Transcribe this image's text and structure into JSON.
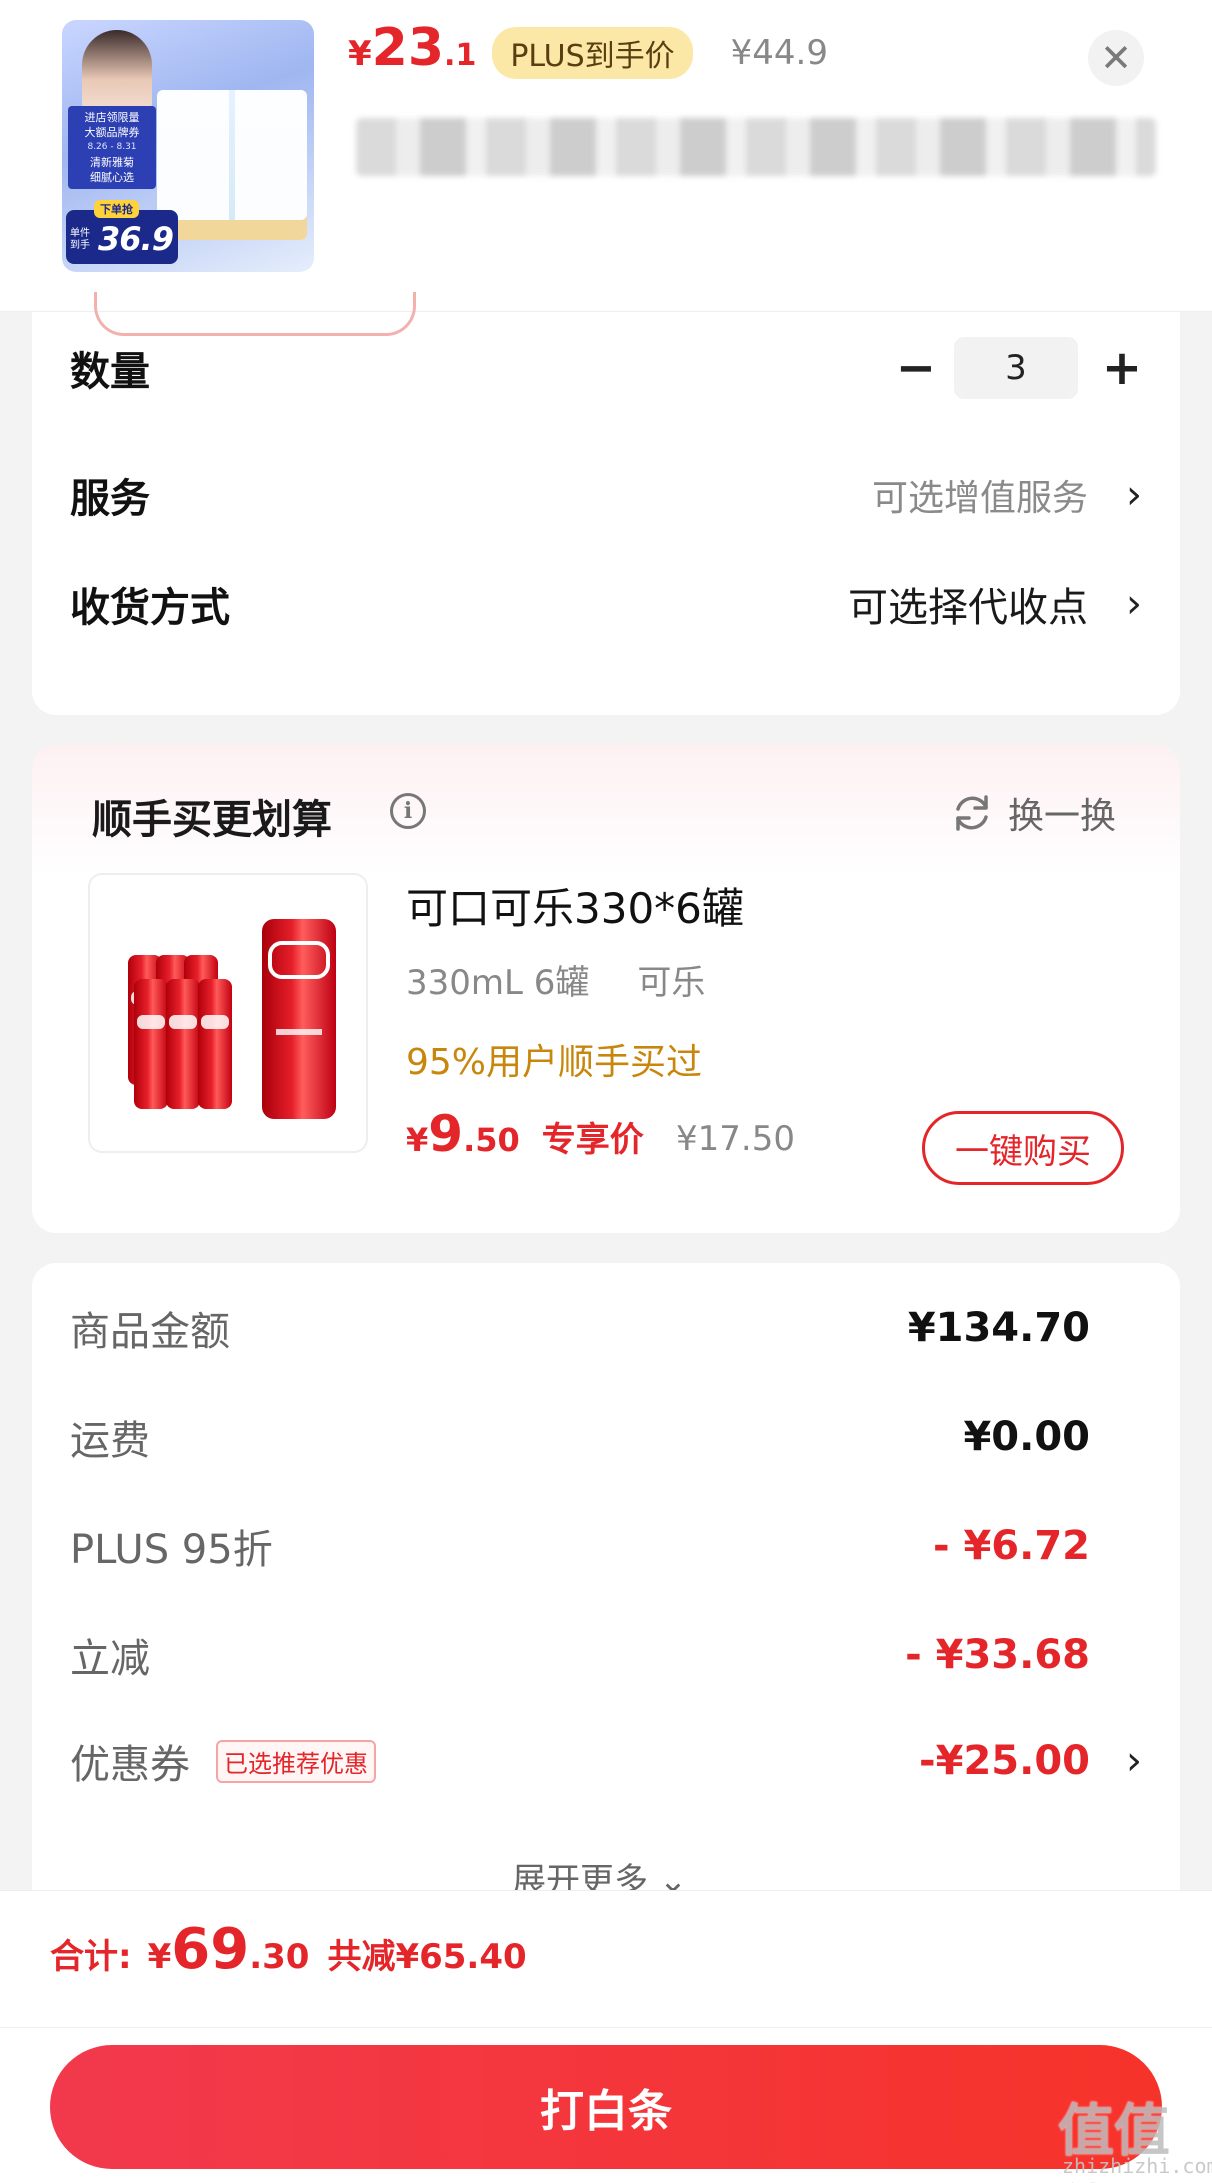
{
  "header": {
    "thumb": {
      "promo_line1": "进店领限量",
      "promo_line2": "大额品牌券",
      "promo_dates": "8.26 - 8.31",
      "promo_line3": "清新雅菊",
      "promo_line4": "细腻心选",
      "badge_tag": "下单抢",
      "badge_label": "单件到手",
      "badge_price": "36.9"
    },
    "price": {
      "currency": "¥",
      "integer": "23",
      "decimal": ".1"
    },
    "plus_tag": "PLUS到手价",
    "original_price": "¥44.9",
    "close_icon": "✕"
  },
  "options": {
    "quantity_label": "数量",
    "quantity_value": "3",
    "minus": "−",
    "plus": "+",
    "service_label": "服务",
    "service_value": "可选增值服务",
    "delivery_label": "收货方式",
    "delivery_value": "可选择代收点",
    "chevron": "›"
  },
  "bundle": {
    "title": "顺手买更划算",
    "info_icon": "i",
    "refresh_label": "换一换",
    "product": {
      "name": "可口可乐330*6罐",
      "spec1": "330mL 6罐",
      "spec2": "可乐",
      "bought": "95%用户顺手买过",
      "price_currency": "¥",
      "price_integer": "9",
      "price_decimal": ".50",
      "exclusive_label": "专享价",
      "original_price": "¥17.50",
      "buy_label": "一键购买"
    }
  },
  "summary": {
    "rows": [
      {
        "label": "商品金额",
        "value": "¥134.70"
      },
      {
        "label": "运费",
        "value": "¥0.00"
      },
      {
        "label": "PLUS 95折",
        "value": "- ¥6.72"
      },
      {
        "label": "立减",
        "value": "- ¥33.68"
      },
      {
        "label": "优惠券",
        "value": "-¥25.00",
        "tag": "已选推荐优惠"
      }
    ],
    "expand_label": "展开更多 ⌄"
  },
  "footer": {
    "total_label": "合计:",
    "total_currency": "¥",
    "total_integer": "69",
    "total_decimal": ".30",
    "saved": "共减¥65.40",
    "pay_label": "打白条"
  },
  "watermark": {
    "main": "值值值",
    "sub": "zhizhizhi.com"
  },
  "colors": {
    "accent_red": "#e4262a",
    "plus_gold": "#fbe8a6",
    "bought_orange": "#c8870c"
  }
}
